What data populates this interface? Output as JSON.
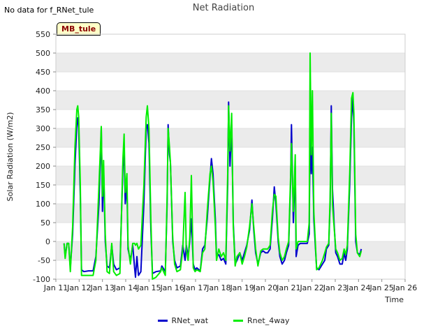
{
  "header": {
    "no_data_text": "No data for f_RNet_tule",
    "site_label": "MB_tule"
  },
  "colors": {
    "series1": "#0000cc",
    "series2": "#00ee00",
    "band": "#ebebeb"
  },
  "chart_data": {
    "type": "line",
    "title": "Net Radiation",
    "xlabel": "Time",
    "ylabel": "Solar Radiation (W/m2)",
    "ylim": [
      -100,
      550
    ],
    "xlim": [
      11,
      26
    ],
    "y_ticks": [
      "-100",
      "-50",
      "0",
      "50",
      "100",
      "150",
      "200",
      "250",
      "300",
      "350",
      "400",
      "450",
      "500",
      "550"
    ],
    "x_ticks": [
      "Jan 11",
      "Jan 12",
      "Jan 13",
      "Jan 14",
      "Jan 15",
      "Jan 16",
      "Jan 17",
      "Jan 18",
      "Jan 19",
      "Jan 20",
      "Jan 21",
      "Jan 22",
      "Jan 23",
      "Jan 24",
      "Jan 25",
      "Jan 26"
    ],
    "grid": "horizontal-bands",
    "legend_position": "bottom-center",
    "series": [
      {
        "name": "RNet_wat",
        "color": "#0000cc",
        "points": [
          [
            11.35,
            -5
          ],
          [
            11.4,
            -40
          ],
          [
            11.48,
            -5
          ],
          [
            11.55,
            -5
          ],
          [
            11.62,
            -70
          ],
          [
            11.72,
            20
          ],
          [
            11.82,
            200
          ],
          [
            11.9,
            310
          ],
          [
            11.94,
            328
          ],
          [
            11.98,
            300
          ],
          [
            12.05,
            120
          ],
          [
            12.1,
            -75
          ],
          [
            12.2,
            -80
          ],
          [
            12.4,
            -78
          ],
          [
            12.6,
            -78
          ],
          [
            12.72,
            -40
          ],
          [
            12.85,
            100
          ],
          [
            12.95,
            300
          ],
          [
            13.0,
            80
          ],
          [
            13.05,
            195
          ],
          [
            13.12,
            0
          ],
          [
            13.2,
            -65
          ],
          [
            13.3,
            -70
          ],
          [
            13.4,
            -10
          ],
          [
            13.48,
            -60
          ],
          [
            13.6,
            -75
          ],
          [
            13.75,
            -70
          ],
          [
            13.88,
            200
          ],
          [
            13.93,
            235
          ],
          [
            13.98,
            100
          ],
          [
            14.05,
            150
          ],
          [
            14.1,
            -20
          ],
          [
            14.2,
            -50
          ],
          [
            14.3,
            -10
          ],
          [
            14.38,
            -70
          ],
          [
            14.42,
            -95
          ],
          [
            14.48,
            -40
          ],
          [
            14.55,
            -90
          ],
          [
            14.65,
            -80
          ],
          [
            14.78,
            100
          ],
          [
            14.88,
            300
          ],
          [
            14.93,
            310
          ],
          [
            15.0,
            260
          ],
          [
            15.08,
            30
          ],
          [
            15.15,
            -85
          ],
          [
            15.3,
            -80
          ],
          [
            15.5,
            -78
          ],
          [
            15.55,
            -65
          ],
          [
            15.7,
            -80
          ],
          [
            15.78,
            100
          ],
          [
            15.82,
            310
          ],
          [
            15.88,
            230
          ],
          [
            15.92,
            210
          ],
          [
            16.02,
            0
          ],
          [
            16.1,
            -50
          ],
          [
            16.2,
            -70
          ],
          [
            16.35,
            -65
          ],
          [
            16.45,
            -10
          ],
          [
            16.55,
            -50
          ],
          [
            16.6,
            -10
          ],
          [
            16.68,
            -40
          ],
          [
            16.75,
            0
          ],
          [
            16.82,
            60
          ],
          [
            16.9,
            -60
          ],
          [
            16.98,
            -75
          ],
          [
            17.05,
            -70
          ],
          [
            17.2,
            -78
          ],
          [
            17.3,
            -20
          ],
          [
            17.4,
            -10
          ],
          [
            17.5,
            60
          ],
          [
            17.62,
            170
          ],
          [
            17.68,
            220
          ],
          [
            17.75,
            180
          ],
          [
            17.85,
            60
          ],
          [
            17.9,
            -40
          ],
          [
            18.0,
            -35
          ],
          [
            18.1,
            -50
          ],
          [
            18.2,
            -45
          ],
          [
            18.3,
            -60
          ],
          [
            18.38,
            150
          ],
          [
            18.42,
            370
          ],
          [
            18.48,
            200
          ],
          [
            18.55,
            310
          ],
          [
            18.62,
            50
          ],
          [
            18.7,
            -60
          ],
          [
            18.78,
            -50
          ],
          [
            18.9,
            -30
          ],
          [
            19.0,
            -50
          ],
          [
            19.1,
            -30
          ],
          [
            19.2,
            -10
          ],
          [
            19.32,
            30
          ],
          [
            19.42,
            110
          ],
          [
            19.5,
            30
          ],
          [
            19.58,
            -30
          ],
          [
            19.68,
            -60
          ],
          [
            19.8,
            -30
          ],
          [
            19.9,
            -25
          ],
          [
            20.0,
            -30
          ],
          [
            20.1,
            -30
          ],
          [
            20.2,
            -20
          ],
          [
            20.3,
            60
          ],
          [
            20.38,
            145
          ],
          [
            20.45,
            100
          ],
          [
            20.55,
            0
          ],
          [
            20.62,
            -40
          ],
          [
            20.72,
            -60
          ],
          [
            20.82,
            -50
          ],
          [
            20.9,
            -30
          ],
          [
            21.0,
            -10
          ],
          [
            21.08,
            150
          ],
          [
            21.12,
            310
          ],
          [
            21.2,
            50
          ],
          [
            21.28,
            200
          ],
          [
            21.32,
            -40
          ],
          [
            21.4,
            -10
          ],
          [
            21.5,
            -5
          ],
          [
            21.6,
            -5
          ],
          [
            21.7,
            -5
          ],
          [
            21.8,
            -5
          ],
          [
            21.88,
            20
          ],
          [
            21.92,
            300
          ],
          [
            21.97,
            180
          ],
          [
            22.02,
            250
          ],
          [
            22.08,
            60
          ],
          [
            22.15,
            -20
          ],
          [
            22.2,
            -70
          ],
          [
            22.3,
            -75
          ],
          [
            22.45,
            -60
          ],
          [
            22.55,
            -50
          ],
          [
            22.62,
            -20
          ],
          [
            22.72,
            -10
          ],
          [
            22.78,
            100
          ],
          [
            22.83,
            360
          ],
          [
            22.88,
            140
          ],
          [
            22.95,
            50
          ],
          [
            23.02,
            -30
          ],
          [
            23.1,
            -40
          ],
          [
            23.2,
            -60
          ],
          [
            23.3,
            -60
          ],
          [
            23.38,
            -30
          ],
          [
            23.45,
            -50
          ],
          [
            23.52,
            -20
          ],
          [
            23.62,
            150
          ],
          [
            23.7,
            330
          ],
          [
            23.76,
            380
          ],
          [
            23.8,
            310
          ],
          [
            23.88,
            0
          ],
          [
            23.95,
            -30
          ],
          [
            24.05,
            -35
          ],
          [
            24.12,
            -20
          ]
        ]
      },
      {
        "name": "Rnet_4way",
        "color": "#00ee00",
        "points": [
          [
            11.35,
            -5
          ],
          [
            11.4,
            -45
          ],
          [
            11.48,
            -5
          ],
          [
            11.55,
            -5
          ],
          [
            11.62,
            -80
          ],
          [
            11.72,
            40
          ],
          [
            11.82,
            250
          ],
          [
            11.9,
            350
          ],
          [
            11.94,
            360
          ],
          [
            11.98,
            330
          ],
          [
            12.05,
            150
          ],
          [
            12.1,
            -90
          ],
          [
            12.2,
            -90
          ],
          [
            12.4,
            -90
          ],
          [
            12.6,
            -90
          ],
          [
            12.72,
            -50
          ],
          [
            12.85,
            150
          ],
          [
            12.95,
            305
          ],
          [
            13.0,
            120
          ],
          [
            13.05,
            215
          ],
          [
            13.12,
            20
          ],
          [
            13.2,
            -80
          ],
          [
            13.3,
            -85
          ],
          [
            13.4,
            -5
          ],
          [
            13.48,
            -80
          ],
          [
            13.6,
            -90
          ],
          [
            13.75,
            -85
          ],
          [
            13.88,
            220
          ],
          [
            13.93,
            285
          ],
          [
            13.98,
            130
          ],
          [
            14.05,
            180
          ],
          [
            14.1,
            -10
          ],
          [
            14.2,
            -60
          ],
          [
            14.3,
            -5
          ],
          [
            14.38,
            -5
          ],
          [
            14.42,
            -10
          ],
          [
            14.48,
            -5
          ],
          [
            14.55,
            -20
          ],
          [
            14.65,
            -10
          ],
          [
            14.78,
            150
          ],
          [
            14.88,
            330
          ],
          [
            14.93,
            360
          ],
          [
            15.0,
            300
          ],
          [
            15.08,
            60
          ],
          [
            15.15,
            -100
          ],
          [
            15.3,
            -95
          ],
          [
            15.5,
            -80
          ],
          [
            15.55,
            -70
          ],
          [
            15.7,
            -90
          ],
          [
            15.78,
            120
          ],
          [
            15.82,
            300
          ],
          [
            15.88,
            250
          ],
          [
            15.92,
            210
          ],
          [
            16.02,
            10
          ],
          [
            16.1,
            -60
          ],
          [
            16.2,
            -80
          ],
          [
            16.35,
            -75
          ],
          [
            16.45,
            -20
          ],
          [
            16.55,
            130
          ],
          [
            16.6,
            -20
          ],
          [
            16.68,
            -50
          ],
          [
            16.75,
            10
          ],
          [
            16.82,
            175
          ],
          [
            16.9,
            -70
          ],
          [
            16.98,
            -80
          ],
          [
            17.05,
            -75
          ],
          [
            17.2,
            -80
          ],
          [
            17.3,
            -30
          ],
          [
            17.4,
            -20
          ],
          [
            17.5,
            80
          ],
          [
            17.62,
            180
          ],
          [
            17.68,
            200
          ],
          [
            17.75,
            160
          ],
          [
            17.85,
            40
          ],
          [
            17.9,
            -50
          ],
          [
            18.0,
            -20
          ],
          [
            18.1,
            -40
          ],
          [
            18.2,
            -30
          ],
          [
            18.3,
            -50
          ],
          [
            18.38,
            180
          ],
          [
            18.42,
            360
          ],
          [
            18.48,
            240
          ],
          [
            18.55,
            340
          ],
          [
            18.62,
            40
          ],
          [
            18.7,
            -65
          ],
          [
            18.78,
            -40
          ],
          [
            18.9,
            -30
          ],
          [
            19.0,
            -60
          ],
          [
            19.1,
            -40
          ],
          [
            19.2,
            -15
          ],
          [
            19.32,
            40
          ],
          [
            19.42,
            100
          ],
          [
            19.5,
            40
          ],
          [
            19.58,
            -20
          ],
          [
            19.68,
            -65
          ],
          [
            19.8,
            -25
          ],
          [
            19.9,
            -20
          ],
          [
            20.0,
            -20
          ],
          [
            20.1,
            -20
          ],
          [
            20.2,
            -10
          ],
          [
            20.3,
            80
          ],
          [
            20.38,
            125
          ],
          [
            20.45,
            120
          ],
          [
            20.55,
            10
          ],
          [
            20.62,
            -30
          ],
          [
            20.72,
            -50
          ],
          [
            20.82,
            -40
          ],
          [
            20.9,
            -20
          ],
          [
            21.0,
            0
          ],
          [
            21.08,
            170
          ],
          [
            21.12,
            260
          ],
          [
            21.2,
            80
          ],
          [
            21.28,
            230
          ],
          [
            21.32,
            -20
          ],
          [
            21.4,
            0
          ],
          [
            21.5,
            0
          ],
          [
            21.6,
            0
          ],
          [
            21.7,
            0
          ],
          [
            21.8,
            0
          ],
          [
            21.88,
            50
          ],
          [
            21.92,
            500
          ],
          [
            21.97,
            230
          ],
          [
            22.02,
            400
          ],
          [
            22.08,
            80
          ],
          [
            22.15,
            -10
          ],
          [
            22.2,
            -75
          ],
          [
            22.3,
            -70
          ],
          [
            22.45,
            -50
          ],
          [
            22.55,
            -30
          ],
          [
            22.62,
            -15
          ],
          [
            22.72,
            -5
          ],
          [
            22.78,
            120
          ],
          [
            22.83,
            340
          ],
          [
            22.88,
            100
          ],
          [
            22.95,
            40
          ],
          [
            23.02,
            -20
          ],
          [
            23.1,
            -30
          ],
          [
            23.2,
            -50
          ],
          [
            23.3,
            -45
          ],
          [
            23.38,
            -20
          ],
          [
            23.45,
            -35
          ],
          [
            23.52,
            -10
          ],
          [
            23.62,
            180
          ],
          [
            23.7,
            380
          ],
          [
            23.76,
            395
          ],
          [
            23.8,
            340
          ],
          [
            23.88,
            20
          ],
          [
            23.95,
            -30
          ],
          [
            24.05,
            -40
          ],
          [
            24.12,
            -25
          ]
        ]
      }
    ]
  },
  "legend": {
    "item1": "RNet_wat",
    "item2": "Rnet_4way"
  }
}
